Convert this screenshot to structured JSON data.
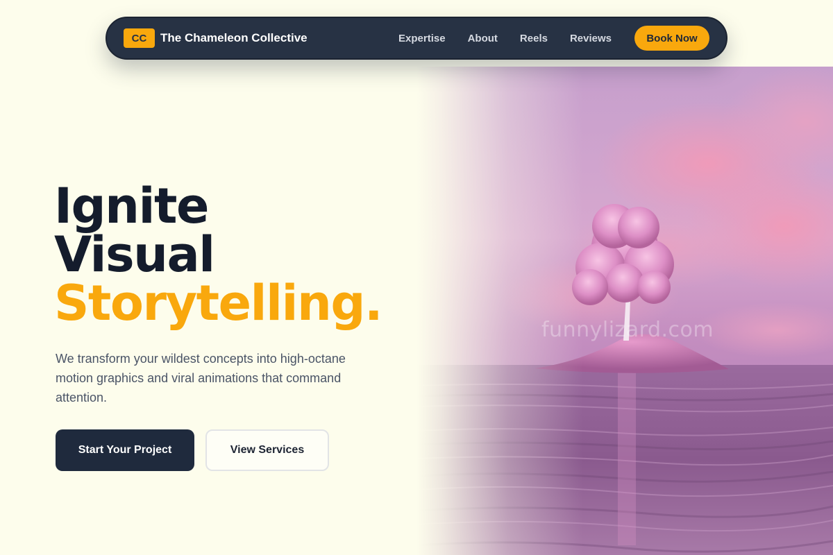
{
  "colors": {
    "background": "#fdfdec",
    "navbar": "#273244",
    "accent": "#f9a80d",
    "headline_dark": "#141c2c",
    "primary_button": "#1f2a3d"
  },
  "navbar": {
    "logo_badge": "CC",
    "brand_name": "The Chameleon Collective",
    "links": [
      "Expertise",
      "About",
      "Reels",
      "Reviews"
    ],
    "cta_label": "Book Now"
  },
  "hero": {
    "headline_line1": "Ignite",
    "headline_line2": "Visual",
    "headline_line3": "Storytelling.",
    "subtitle": "We transform your wildest concepts into high-octane motion graphics and viral animations that command attention.",
    "primary_button": "Start Your Project",
    "secondary_button": "View Services"
  },
  "image": {
    "watermark": "funnylizard.com"
  }
}
